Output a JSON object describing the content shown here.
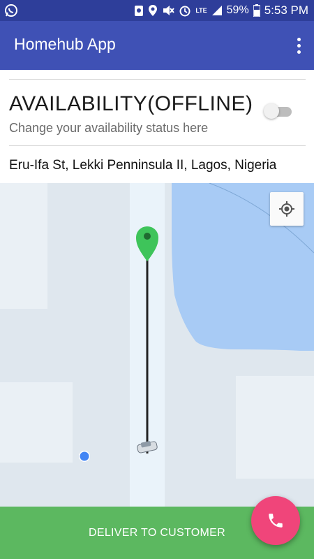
{
  "status_bar": {
    "battery": "59%",
    "time": "5:53 PM",
    "network": "LTE",
    "icons": [
      "whatsapp-icon",
      "android-notification-icon",
      "location-icon",
      "mute-icon",
      "alarm-icon",
      "signal-icon",
      "battery-icon"
    ]
  },
  "app_bar": {
    "title": "Homehub App",
    "menu_icon": "overflow-menu-icon"
  },
  "availability": {
    "title": "AVAILABILITY(OFFLINE)",
    "subtitle": "Change your availability status here",
    "toggle_on": false
  },
  "address": "Eru-Ifa St, Lekki Penninsula II, Lagos, Nigeria",
  "map": {
    "locate_button_icon": "my-location-icon",
    "markers": [
      "destination-pin-icon",
      "car-icon",
      "current-location-dot"
    ]
  },
  "actions": {
    "deliver_label": "DELIVER TO CUSTOMER",
    "call_icon": "phone-icon"
  },
  "colors": {
    "status_bar": "#2e3e9a",
    "app_bar": "#3f51b5",
    "deliver_bar": "#5cb860",
    "fab": "#f0457a",
    "pin": "#3ec45a",
    "water": "#a8cbf5"
  }
}
